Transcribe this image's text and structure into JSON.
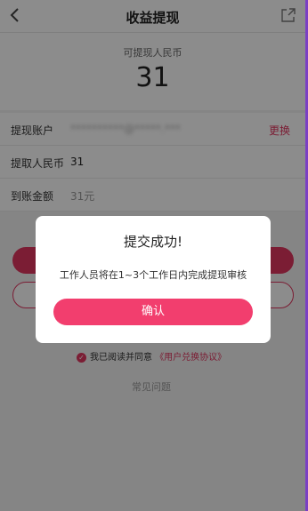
{
  "header": {
    "title": "收益提现",
    "back_icon": "chevron-left-icon",
    "share_icon": "share-icon"
  },
  "amount": {
    "label": "可提现人民币",
    "value": "31"
  },
  "rows": {
    "account_label": "提现账户",
    "account_value": "**********@*****.***",
    "change_label": "更换",
    "withdraw_label": "提取人民币",
    "withdraw_value": "31",
    "arrival_label": "到账金额",
    "arrival_value": "31元"
  },
  "agreement": {
    "prefix": "我已阅读并同意",
    "link": "《用户兑换协议》"
  },
  "faq": "常见问题",
  "dialog": {
    "title": "提交成功!",
    "message": "工作人员将在1~3个工作日内完成提现审核",
    "confirm": "确认"
  },
  "colors": {
    "accent": "#e0355f",
    "dialog_button": "#f23e6e",
    "frame": "#7b3fc4"
  }
}
